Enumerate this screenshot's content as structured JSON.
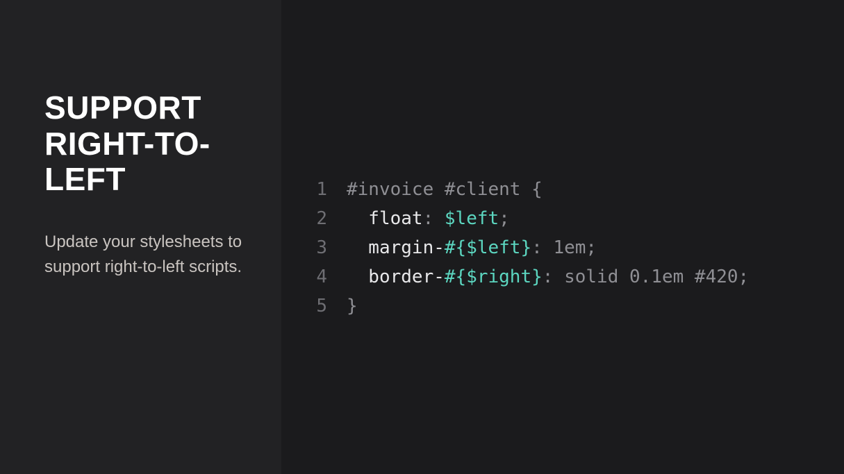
{
  "sidebar": {
    "title": "SUPPORT RIGHT-TO-LEFT",
    "description": "Update your stylesheets to support right-to-left scripts."
  },
  "code": {
    "lineNumbers": [
      "1",
      "2",
      "3",
      "4",
      "5"
    ],
    "lines": [
      [
        {
          "cls": "tok-dim",
          "text": "#invoice #client {"
        }
      ],
      [
        {
          "cls": "tok-plain",
          "text": "  float"
        },
        {
          "cls": "tok-dim",
          "text": ": "
        },
        {
          "cls": "tok-accent",
          "text": "$left"
        },
        {
          "cls": "tok-dim",
          "text": ";"
        }
      ],
      [
        {
          "cls": "tok-plain",
          "text": "  margin-"
        },
        {
          "cls": "tok-accent",
          "text": "#{$left}"
        },
        {
          "cls": "tok-dim",
          "text": ": "
        },
        {
          "cls": "tok-value",
          "text": "1em"
        },
        {
          "cls": "tok-dim",
          "text": ";"
        }
      ],
      [
        {
          "cls": "tok-plain",
          "text": "  border-"
        },
        {
          "cls": "tok-accent",
          "text": "#{$right}"
        },
        {
          "cls": "tok-dim",
          "text": ": "
        },
        {
          "cls": "tok-value",
          "text": "solid 0.1em #420"
        },
        {
          "cls": "tok-dim",
          "text": ";"
        }
      ],
      [
        {
          "cls": "tok-dim",
          "text": "}"
        }
      ]
    ]
  }
}
